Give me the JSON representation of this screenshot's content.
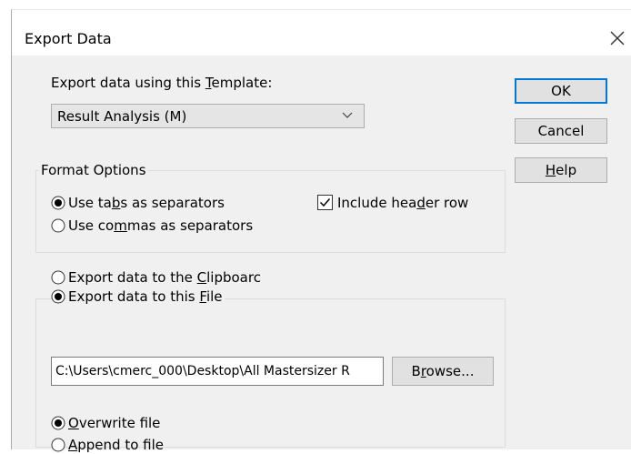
{
  "dialog": {
    "title": "Export Data"
  },
  "template": {
    "label_pre": "Export data using this ",
    "label_key": "T",
    "label_post": "emplate:",
    "selected": "Result Analysis (M)"
  },
  "format_options": {
    "legend": "Format Options",
    "tabs": {
      "pre": "Use ta",
      "key": "b",
      "post": "s as separators",
      "checked": true
    },
    "commas": {
      "pre": "Use co",
      "key": "m",
      "post": "mas as separators",
      "checked": false
    },
    "header": {
      "pre": "Include hea",
      "key": "d",
      "post": "er row",
      "checked": true
    }
  },
  "destination": {
    "clipboard": {
      "pre": "Export data to the ",
      "key": "C",
      "post": "lipboarc",
      "checked": false
    },
    "file": {
      "pre": "Export data to this ",
      "key": "F",
      "post": "ile",
      "checked": true
    },
    "path": "C:\\Users\\cmerc_000\\Desktop\\All Mastersizer R",
    "browse": {
      "pre": "B",
      "key": "r",
      "post": "owse..."
    },
    "overwrite": {
      "pre": "",
      "key": "O",
      "post": "verwrite file",
      "checked": true
    },
    "append": {
      "pre": "",
      "key": "A",
      "post": "ppend to file",
      "checked": false
    }
  },
  "buttons": {
    "ok": "OK",
    "cancel": "Cancel",
    "help": {
      "pre": "",
      "key": "H",
      "post": "elp"
    }
  },
  "colors": {
    "accent": "#0078d7",
    "dialog_bg": "#f0f0f0",
    "button_bg": "#e1e1e1"
  }
}
